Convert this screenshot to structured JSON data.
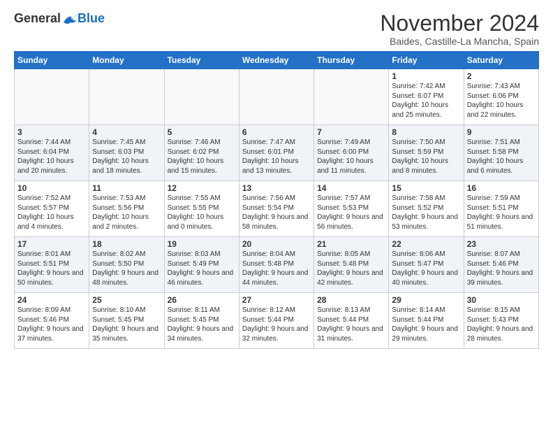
{
  "logo": {
    "general": "General",
    "blue": "Blue"
  },
  "header": {
    "month": "November 2024",
    "location": "Baides, Castille-La Mancha, Spain"
  },
  "days_of_week": [
    "Sunday",
    "Monday",
    "Tuesday",
    "Wednesday",
    "Thursday",
    "Friday",
    "Saturday"
  ],
  "weeks": [
    [
      {
        "day": "",
        "info": ""
      },
      {
        "day": "",
        "info": ""
      },
      {
        "day": "",
        "info": ""
      },
      {
        "day": "",
        "info": ""
      },
      {
        "day": "",
        "info": ""
      },
      {
        "day": "1",
        "info": "Sunrise: 7:42 AM\nSunset: 6:07 PM\nDaylight: 10 hours and 25 minutes."
      },
      {
        "day": "2",
        "info": "Sunrise: 7:43 AM\nSunset: 6:06 PM\nDaylight: 10 hours and 22 minutes."
      }
    ],
    [
      {
        "day": "3",
        "info": "Sunrise: 7:44 AM\nSunset: 6:04 PM\nDaylight: 10 hours and 20 minutes."
      },
      {
        "day": "4",
        "info": "Sunrise: 7:45 AM\nSunset: 6:03 PM\nDaylight: 10 hours and 18 minutes."
      },
      {
        "day": "5",
        "info": "Sunrise: 7:46 AM\nSunset: 6:02 PM\nDaylight: 10 hours and 15 minutes."
      },
      {
        "day": "6",
        "info": "Sunrise: 7:47 AM\nSunset: 6:01 PM\nDaylight: 10 hours and 13 minutes."
      },
      {
        "day": "7",
        "info": "Sunrise: 7:49 AM\nSunset: 6:00 PM\nDaylight: 10 hours and 11 minutes."
      },
      {
        "day": "8",
        "info": "Sunrise: 7:50 AM\nSunset: 5:59 PM\nDaylight: 10 hours and 8 minutes."
      },
      {
        "day": "9",
        "info": "Sunrise: 7:51 AM\nSunset: 5:58 PM\nDaylight: 10 hours and 6 minutes."
      }
    ],
    [
      {
        "day": "10",
        "info": "Sunrise: 7:52 AM\nSunset: 5:57 PM\nDaylight: 10 hours and 4 minutes."
      },
      {
        "day": "11",
        "info": "Sunrise: 7:53 AM\nSunset: 5:56 PM\nDaylight: 10 hours and 2 minutes."
      },
      {
        "day": "12",
        "info": "Sunrise: 7:55 AM\nSunset: 5:55 PM\nDaylight: 10 hours and 0 minutes."
      },
      {
        "day": "13",
        "info": "Sunrise: 7:56 AM\nSunset: 5:54 PM\nDaylight: 9 hours and 58 minutes."
      },
      {
        "day": "14",
        "info": "Sunrise: 7:57 AM\nSunset: 5:53 PM\nDaylight: 9 hours and 56 minutes."
      },
      {
        "day": "15",
        "info": "Sunrise: 7:58 AM\nSunset: 5:52 PM\nDaylight: 9 hours and 53 minutes."
      },
      {
        "day": "16",
        "info": "Sunrise: 7:59 AM\nSunset: 5:51 PM\nDaylight: 9 hours and 51 minutes."
      }
    ],
    [
      {
        "day": "17",
        "info": "Sunrise: 8:01 AM\nSunset: 5:51 PM\nDaylight: 9 hours and 50 minutes."
      },
      {
        "day": "18",
        "info": "Sunrise: 8:02 AM\nSunset: 5:50 PM\nDaylight: 9 hours and 48 minutes."
      },
      {
        "day": "19",
        "info": "Sunrise: 8:03 AM\nSunset: 5:49 PM\nDaylight: 9 hours and 46 minutes."
      },
      {
        "day": "20",
        "info": "Sunrise: 8:04 AM\nSunset: 5:48 PM\nDaylight: 9 hours and 44 minutes."
      },
      {
        "day": "21",
        "info": "Sunrise: 8:05 AM\nSunset: 5:48 PM\nDaylight: 9 hours and 42 minutes."
      },
      {
        "day": "22",
        "info": "Sunrise: 8:06 AM\nSunset: 5:47 PM\nDaylight: 9 hours and 40 minutes."
      },
      {
        "day": "23",
        "info": "Sunrise: 8:07 AM\nSunset: 5:46 PM\nDaylight: 9 hours and 39 minutes."
      }
    ],
    [
      {
        "day": "24",
        "info": "Sunrise: 8:09 AM\nSunset: 5:46 PM\nDaylight: 9 hours and 37 minutes."
      },
      {
        "day": "25",
        "info": "Sunrise: 8:10 AM\nSunset: 5:45 PM\nDaylight: 9 hours and 35 minutes."
      },
      {
        "day": "26",
        "info": "Sunrise: 8:11 AM\nSunset: 5:45 PM\nDaylight: 9 hours and 34 minutes."
      },
      {
        "day": "27",
        "info": "Sunrise: 8:12 AM\nSunset: 5:44 PM\nDaylight: 9 hours and 32 minutes."
      },
      {
        "day": "28",
        "info": "Sunrise: 8:13 AM\nSunset: 5:44 PM\nDaylight: 9 hours and 31 minutes."
      },
      {
        "day": "29",
        "info": "Sunrise: 8:14 AM\nSunset: 5:44 PM\nDaylight: 9 hours and 29 minutes."
      },
      {
        "day": "30",
        "info": "Sunrise: 8:15 AM\nSunset: 5:43 PM\nDaylight: 9 hours and 28 minutes."
      }
    ]
  ]
}
